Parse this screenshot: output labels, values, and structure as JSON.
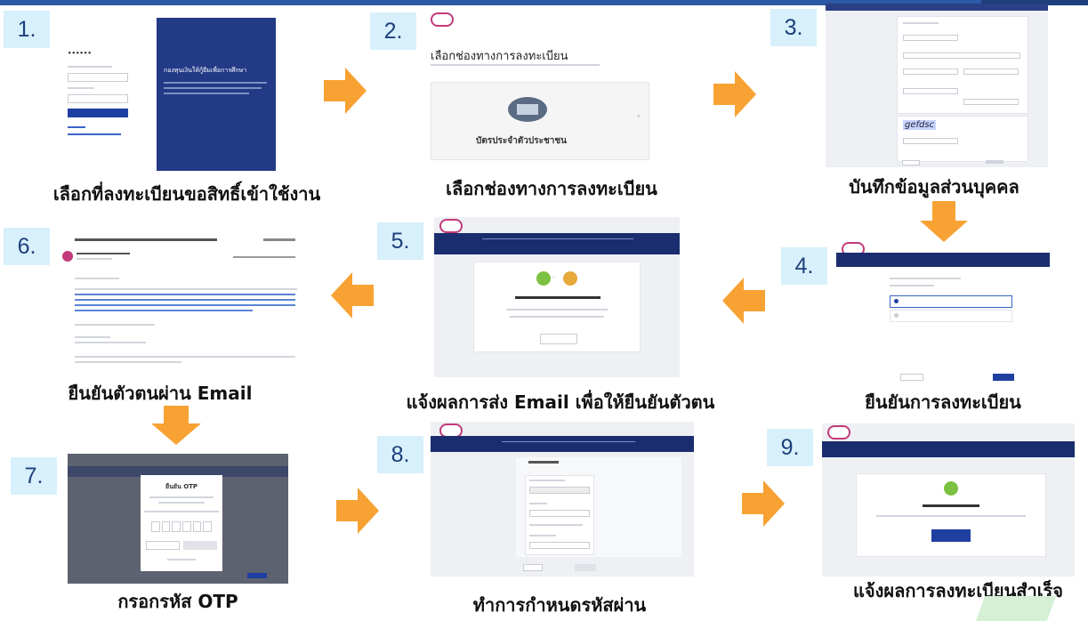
{
  "steps": [
    {
      "number": "1.",
      "caption": "เลือกที่ลงทะเบียนขอสิทธิ์เข้าใช้งาน",
      "screen_title": "กองทุนเงินให้กู้ยืมเพื่อการศึกษา"
    },
    {
      "number": "2.",
      "caption": "เลือกช่องทางการลงทะเบียน",
      "screen_title": "เลือกช่องทางการลงทะเบียน",
      "screen_card": "บัตรประจำตัวประชาชน"
    },
    {
      "number": "3.",
      "caption": "บันทึกข้อมูลส่วนบุคคล",
      "screen_captcha": "gefdsc"
    },
    {
      "number": "4.",
      "caption": "ยืนยันการลงทะเบียน"
    },
    {
      "number": "5.",
      "caption": "แจ้งผลการส่ง Email เพื่อให้ยืนยันตัวตน"
    },
    {
      "number": "6.",
      "caption": "ยืนยันตัวตนผ่าน Email"
    },
    {
      "number": "7.",
      "caption": "กรอกรหัส OTP",
      "screen_title": "ยืนยัน OTP"
    },
    {
      "number": "8.",
      "caption": "ทำการกำหนดรหัสผ่าน"
    },
    {
      "number": "9.",
      "caption": "แจ้งผลการลงทะเบียนสำเร็จ"
    }
  ],
  "icons": {
    "flow_arrow": "arrow-icon",
    "success": "check-circle-icon",
    "brand": "logo-icon"
  },
  "colors": {
    "arrow": "#f7a233",
    "badge_bg": "#d7f0fb",
    "badge_text": "#1d3f7c",
    "nav": "#1a2d6e",
    "primary_button": "#1f3fa0",
    "success": "#7cc142"
  }
}
